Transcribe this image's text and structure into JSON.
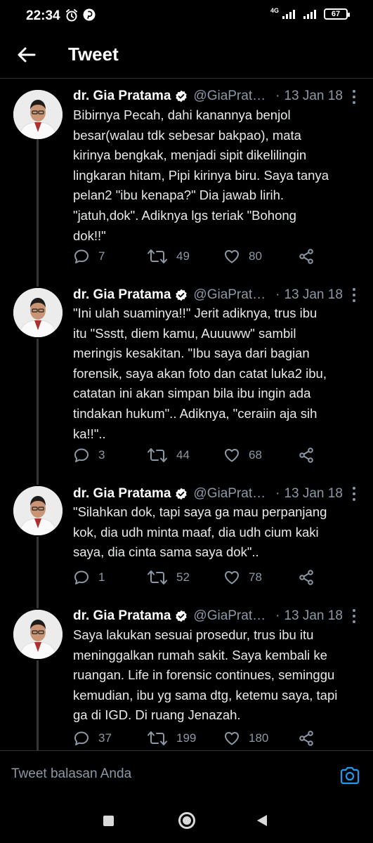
{
  "status": {
    "time": "22:34",
    "network": "4G",
    "battery": "67"
  },
  "header": {
    "title": "Tweet"
  },
  "author": {
    "name": "dr. Gia Pratama",
    "handle": "@GiaPrat…"
  },
  "tweets": [
    {
      "name": "dr. Gia Pratama",
      "handle": "@GiaPrat…",
      "dot": "·",
      "date": "13 Jan 18",
      "lines": [
        "Bibirnya Pecah, dahi kanannya benjol",
        "besar(walau tdk sebesar bakpao), mata",
        "kirinya bengkak, menjadi sipit dikelilingin",
        "lingkaran hitam, Pipi kirinya biru. Saya tanya",
        "pelan2 \"ibu kenapa?\" Dia jawab lirih.",
        "\"jatuh,dok\". Adiknya lgs teriak \"Bohong",
        "dok!!\""
      ],
      "replies": "7",
      "retweets": "49",
      "likes": "80"
    },
    {
      "name": "dr. Gia Pratama",
      "handle": "@GiaPrat…",
      "dot": "·",
      "date": "13 Jan 18",
      "lines": [
        "\"Ini ulah suaminya!!\" Jerit adiknya, trus ibu",
        "itu \"Ssstt, diem kamu, Auuuww\" sambil",
        "meringis kesakitan. \"Ibu saya dari bagian",
        "forensik, saya akan foto dan catat luka2 ibu,",
        "catatan ini akan simpan bila ibu ingin ada",
        "tindakan hukum\".. Adiknya, \"ceraiin aja sih",
        "ka!!\".."
      ],
      "replies": "3",
      "retweets": "44",
      "likes": "68"
    },
    {
      "name": "dr. Gia Pratama",
      "handle": "@GiaPrat…",
      "dot": "·",
      "date": "13 Jan 18",
      "lines": [
        "\"Silahkan dok, tapi saya ga mau perpanjang",
        "kok, dia udh minta maaf, dia udh cium kaki",
        "saya, dia cinta sama saya dok\".."
      ],
      "replies": "1",
      "retweets": "52",
      "likes": "78"
    },
    {
      "name": "dr. Gia Pratama",
      "handle": "@GiaPrat…",
      "dot": "·",
      "date": "13 Jan 18",
      "lines": [
        "Saya lakukan sesuai prosedur, trus ibu itu",
        "meninggalkan rumah sakit. Saya kembali ke",
        "ruangan. Life in forensic continues, seminggu",
        "kemudian, ibu yg sama dtg, ketemu saya, tapi",
        "ga di IGD. Di ruang Jenazah."
      ],
      "replies": "37",
      "retweets": "199",
      "likes": "180"
    }
  ],
  "reply_bar": {
    "placeholder": "Tweet balasan Anda"
  },
  "colors": {
    "background": "#000000",
    "text": "#e7e9ea",
    "muted": "#8b98a5",
    "accent": "#1d9bf0",
    "divider": "#2f3336"
  }
}
